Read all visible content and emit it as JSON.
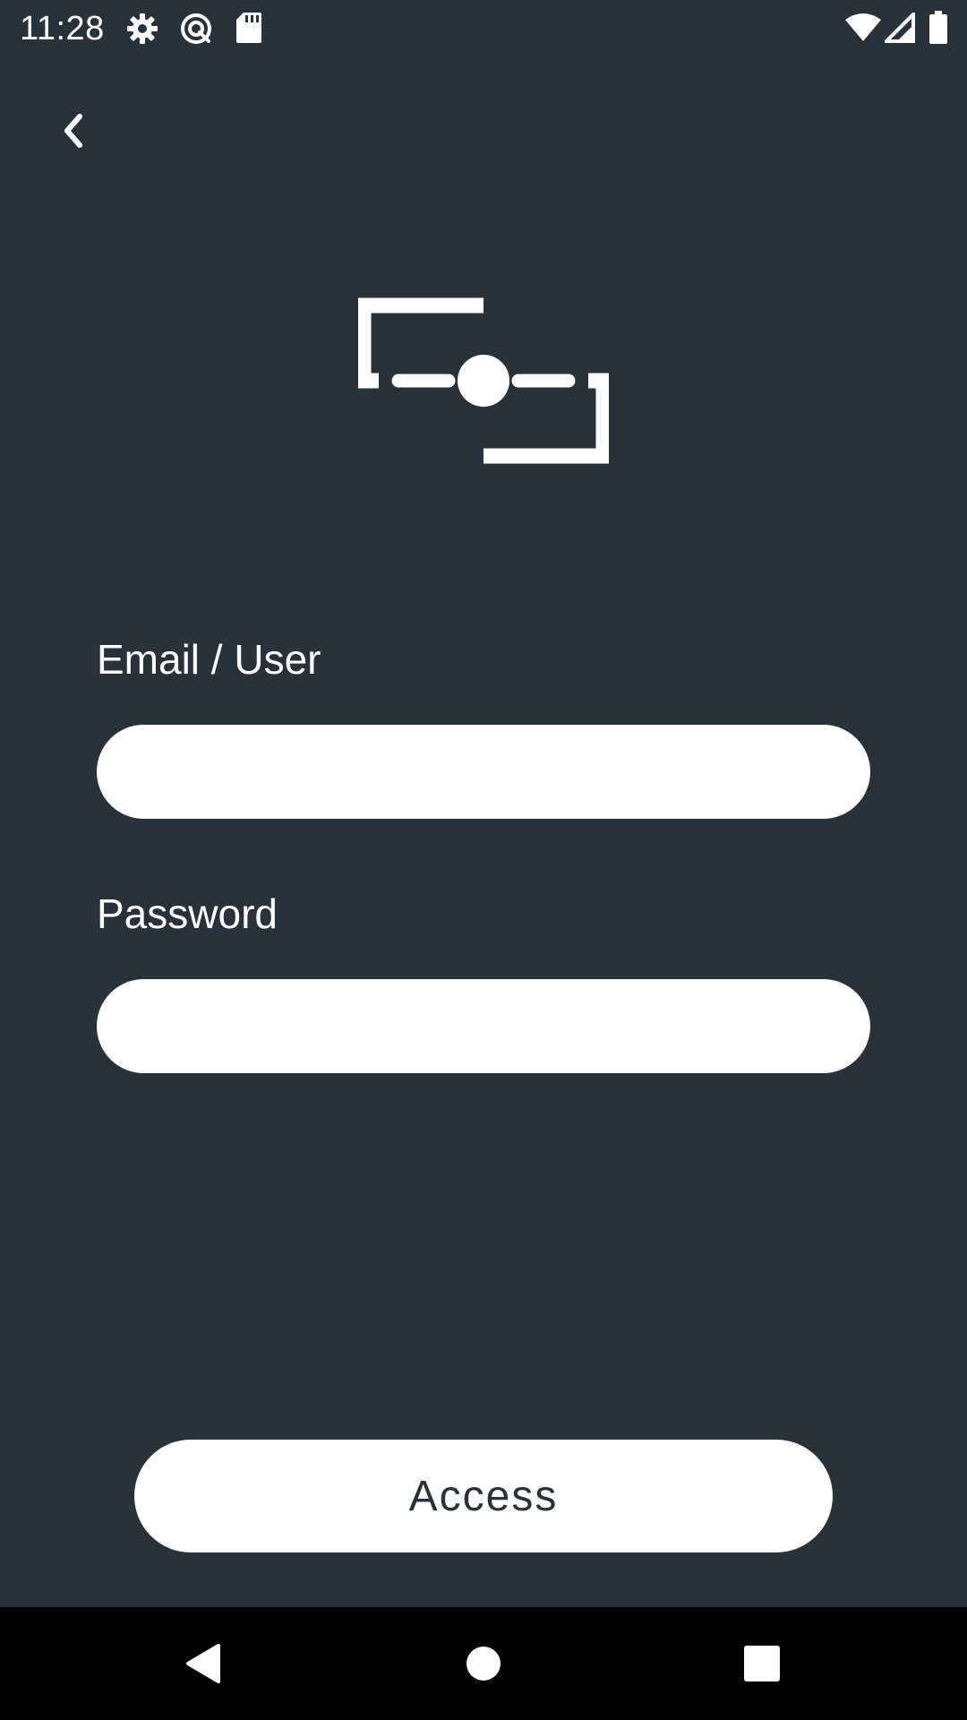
{
  "status_bar": {
    "time": "11:28",
    "left_icons": [
      "gear-icon",
      "sync-circle-icon",
      "sd-card-icon"
    ],
    "right_icons": [
      "wifi-icon",
      "cellular-signal-icon",
      "battery-icon"
    ]
  },
  "header": {
    "back_icon": "chevron-left-icon"
  },
  "logo": {
    "icon": "frame-slider-logo-icon"
  },
  "form": {
    "email_label": "Email / User",
    "email_value": "",
    "password_label": "Password",
    "password_value": ""
  },
  "actions": {
    "access_label": "Access"
  },
  "navigation_bar": {
    "items": [
      "back-triangle-icon",
      "home-circle-icon",
      "recents-square-icon"
    ]
  },
  "colors": {
    "background": "#28323a",
    "foreground": "#ffffff",
    "nav_background": "#000000"
  }
}
